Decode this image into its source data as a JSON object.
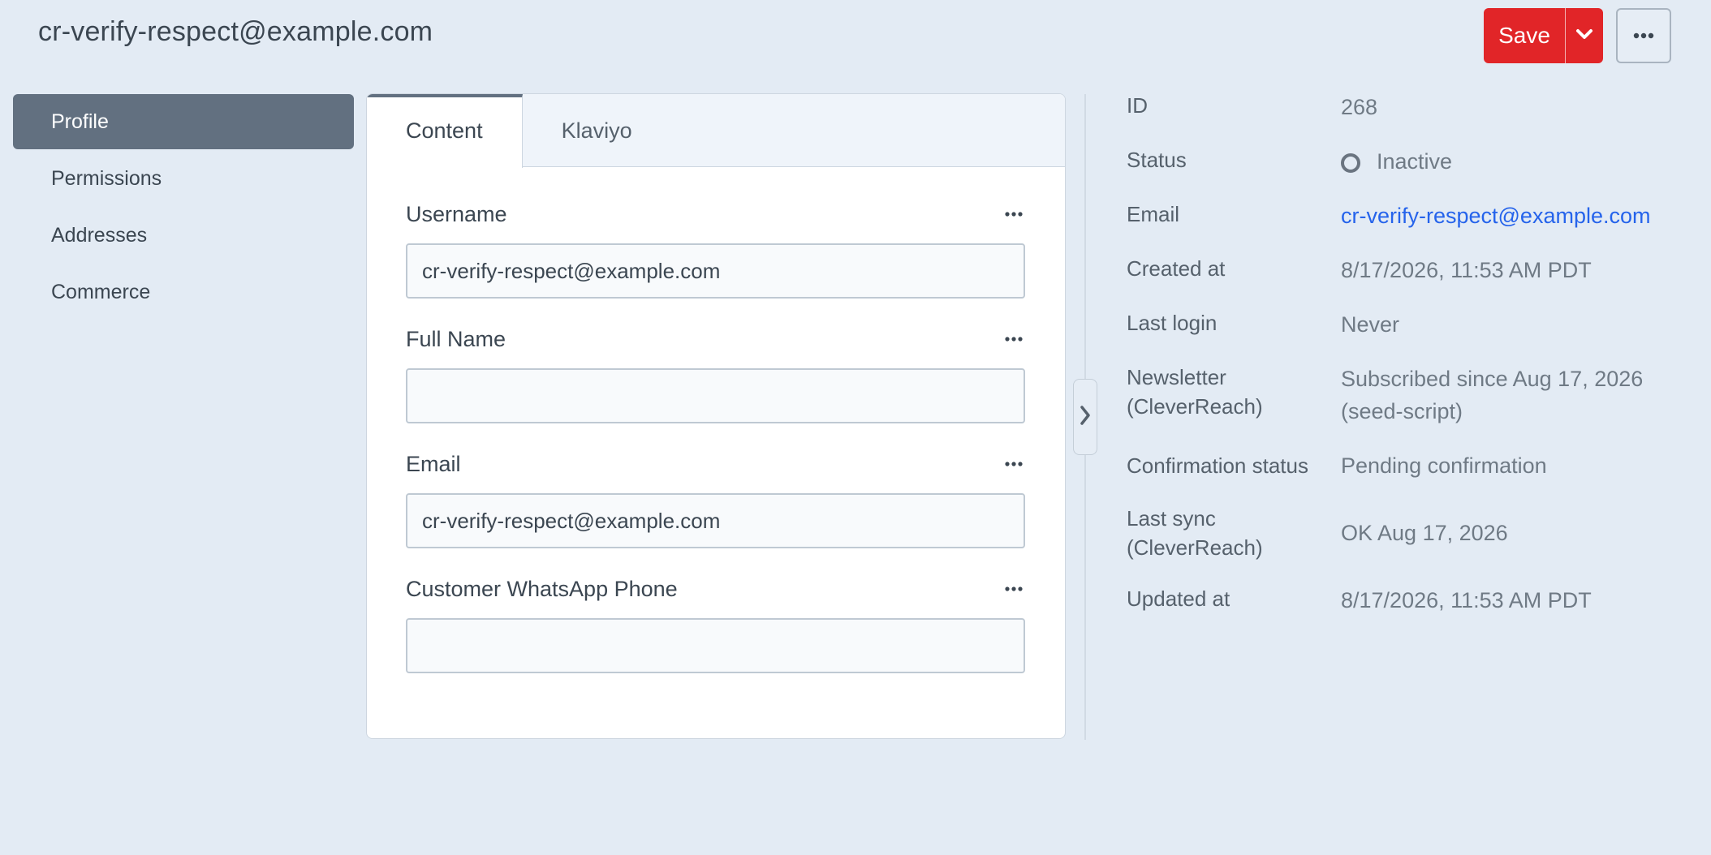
{
  "header": {
    "title": "cr-verify-respect@example.com",
    "save_label": "Save",
    "save_caret_icon": "chevron-down-icon",
    "more_icon": "ellipsis-icon"
  },
  "sidebar": {
    "items": [
      {
        "label": "Profile",
        "active": true
      },
      {
        "label": "Permissions",
        "active": false
      },
      {
        "label": "Addresses",
        "active": false
      },
      {
        "label": "Commerce",
        "active": false
      }
    ]
  },
  "tabs": [
    {
      "label": "Content",
      "active": true
    },
    {
      "label": "Klaviyo",
      "active": false
    }
  ],
  "form": {
    "fields": [
      {
        "label": "Username",
        "value": "cr-verify-respect@example.com"
      },
      {
        "label": "Full Name",
        "value": ""
      },
      {
        "label": "Email",
        "value": "cr-verify-respect@example.com"
      },
      {
        "label": "Customer WhatsApp Phone",
        "value": ""
      }
    ]
  },
  "details": {
    "id": {
      "label": "ID",
      "value": "268"
    },
    "status": {
      "label": "Status",
      "value": "Inactive"
    },
    "email": {
      "label": "Email",
      "value": "cr-verify-respect@example.com"
    },
    "created_at": {
      "label": "Created at",
      "value": "8/17/2026, 11:53 AM PDT"
    },
    "last_login": {
      "label": "Last login",
      "value": "Never"
    },
    "newsletter": {
      "label": "Newsletter (CleverReach)",
      "value": "Subscribed since Aug 17, 2026 (seed-script)"
    },
    "confirmation": {
      "label": "Confirmation status",
      "value": "Pending confirmation"
    },
    "last_sync": {
      "label": "Last sync (CleverReach)",
      "value": "OK Aug 17, 2026"
    },
    "updated_at": {
      "label": "Updated at",
      "value": "8/17/2026, 11:53 AM PDT"
    }
  },
  "colors": {
    "background": "#e3ebf4",
    "accent": "#e12528",
    "sidebar_active": "#627080",
    "link": "#2563eb"
  }
}
